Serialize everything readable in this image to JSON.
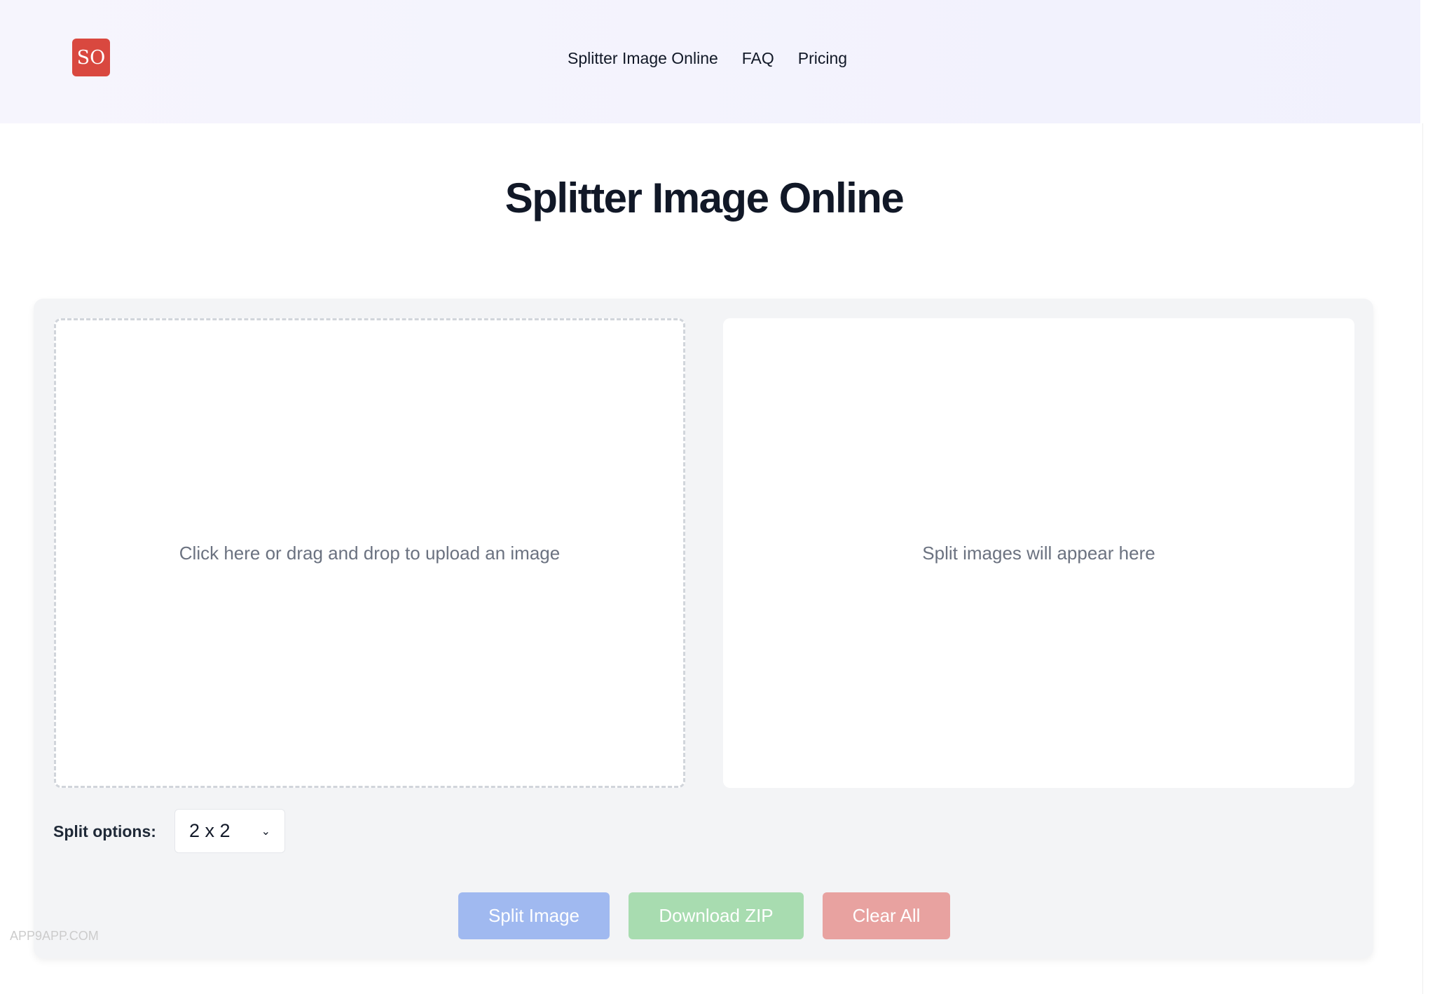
{
  "header": {
    "logo": "SO",
    "nav": [
      "Splitter Image Online",
      "FAQ",
      "Pricing"
    ]
  },
  "main": {
    "title": "Splitter Image Online",
    "upload_text": "Click here or drag and drop to upload an image",
    "output_text": "Split images will appear here",
    "split_label": "Split options:",
    "split_value": "2 x 2",
    "buttons": {
      "split": "Split Image",
      "download": "Download ZIP",
      "clear": "Clear All"
    }
  },
  "colors": {
    "logo": "#d9483f",
    "split": "#a0b9f0",
    "download": "#a8dcb0",
    "clear": "#e8a2a0"
  },
  "watermark": "APP9APP.COM"
}
